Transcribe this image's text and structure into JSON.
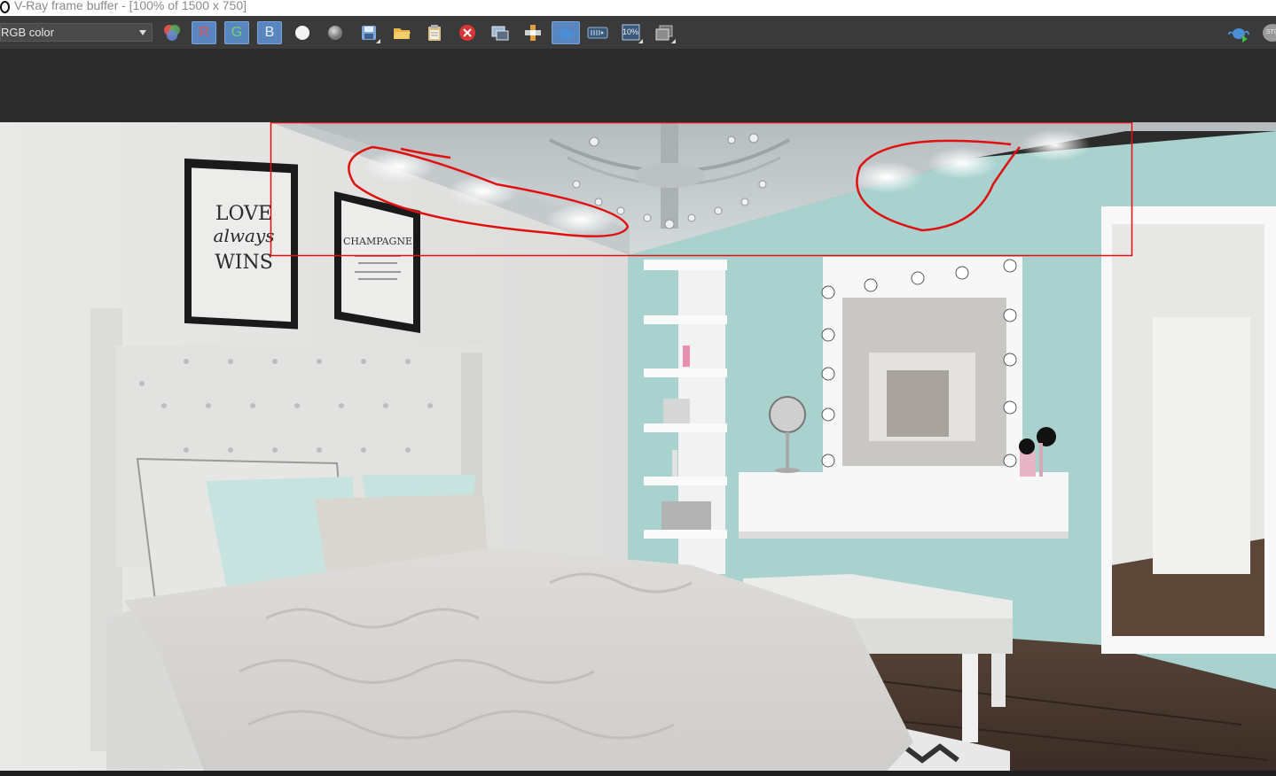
{
  "window": {
    "title": "V-Ray frame buffer - [100% of 1500 x 750]"
  },
  "toolbar": {
    "channel": "RGB color",
    "buttons": [
      {
        "name": "color-balls-icon"
      },
      {
        "name": "red-channel-button",
        "label": "R",
        "color": "#e05050"
      },
      {
        "name": "green-channel-button",
        "label": "G",
        "color": "#66c266"
      },
      {
        "name": "blue-channel-button",
        "label": "B",
        "color": "#e8f0ff"
      },
      {
        "name": "white-circle-icon"
      },
      {
        "name": "gray-circle-icon"
      },
      {
        "name": "save-icon"
      },
      {
        "name": "open-folder-icon"
      },
      {
        "name": "clipboard-icon"
      },
      {
        "name": "clear-icon"
      },
      {
        "name": "region-render-icon"
      },
      {
        "name": "track-mouse-icon"
      },
      {
        "name": "teapot-render-icon"
      },
      {
        "name": "lens-effects-icon"
      },
      {
        "name": "zoom-10-icon",
        "label": "10%"
      },
      {
        "name": "history-icon"
      },
      {
        "name": "teapot-start-icon"
      },
      {
        "name": "stop-icon",
        "label": "STO"
      }
    ]
  },
  "render": {
    "wall_art_1": {
      "line1": "LOVE",
      "line2": "always",
      "line3": "WINS"
    },
    "wall_art_2": {
      "line1": "CHAMPAGNE"
    },
    "accent": "#a8d3d0",
    "annotation_color": "#e01010"
  }
}
